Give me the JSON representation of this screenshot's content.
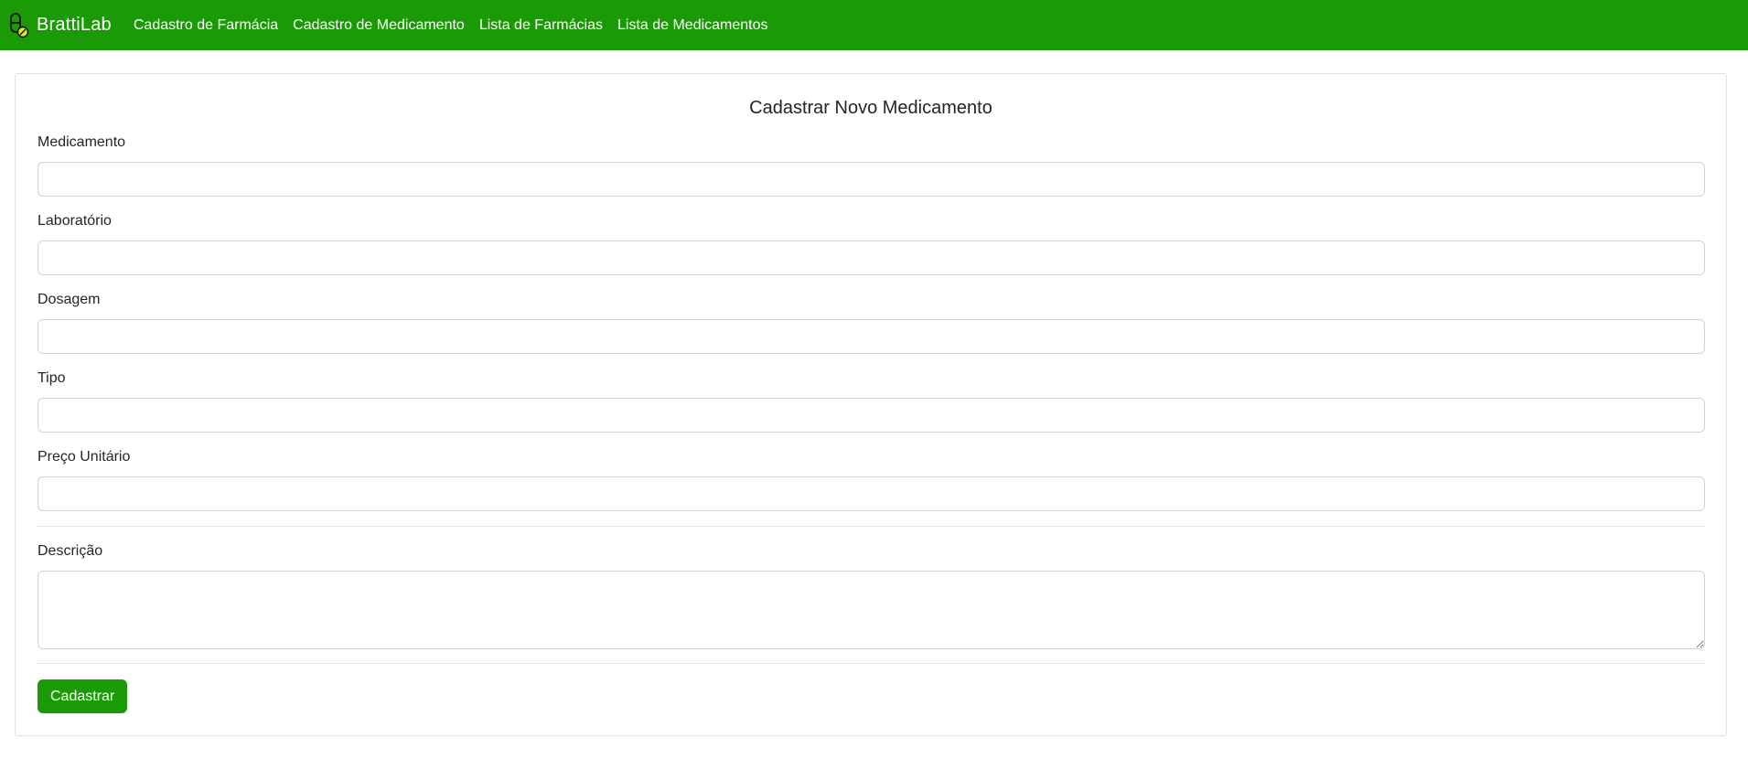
{
  "navbar": {
    "brand": "BrattiLab",
    "brand_icon": "pill-icon",
    "links": [
      {
        "label": "Cadastro de Farmácia"
      },
      {
        "label": "Cadastro de Medicamento"
      },
      {
        "label": "Lista de Farmácias"
      },
      {
        "label": "Lista de Medicamentos"
      }
    ],
    "color": "#1a9a04"
  },
  "form": {
    "title": "Cadastrar Novo Medicamento",
    "fields": {
      "medicamento": {
        "label": "Medicamento",
        "value": ""
      },
      "laboratorio": {
        "label": "Laboratório",
        "value": ""
      },
      "dosagem": {
        "label": "Dosagem",
        "value": ""
      },
      "tipo": {
        "label": "Tipo",
        "value": ""
      },
      "preco": {
        "label": "Preço Unitário",
        "value": ""
      },
      "descricao": {
        "label": "Descrição",
        "value": ""
      }
    },
    "submit_label": "Cadastrar",
    "accent_color": "#1a9a04"
  }
}
